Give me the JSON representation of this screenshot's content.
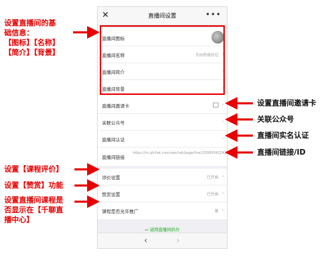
{
  "nav": {
    "close": "✕",
    "title": "直播间设置",
    "more": "•••"
  },
  "groups": {
    "basic": [
      {
        "label": "直播间图标",
        "value": ""
      },
      {
        "label": "直播间名称",
        "value": "大伙的成长记"
      },
      {
        "label": "直播间简介",
        "value": ""
      },
      {
        "label": "直播间背景",
        "value": ""
      }
    ],
    "channel": [
      {
        "label": "直播间邀请卡",
        "value": ""
      },
      {
        "label": "关联公众号",
        "value": ""
      },
      {
        "label": "直播间认证",
        "value": ""
      },
      {
        "label": "直播间链接",
        "value": "https://m.qlchat.com/wechat/page/live/2000004224247772"
      }
    ],
    "course": [
      {
        "label": "评价设置",
        "value": "已开启"
      },
      {
        "label": "赞赏设置",
        "value": "已开启"
      },
      {
        "label": "课程是否允许推广",
        "value": "是"
      }
    ]
  },
  "back_link": "↩ 返回直播间后台",
  "bottom": {
    "prev": "‹",
    "next": "›"
  },
  "chevron": "›",
  "annotations": {
    "basic": [
      "设置直播间的基",
      "础信息：",
      "【图标】【名称】",
      "【简介】【背景】"
    ],
    "invite": "设置直播间邀请卡",
    "account": "关联公众号",
    "auth": "直播间实名认证",
    "link": "直播间链接/ID",
    "eval": "设置【课程评价】",
    "reward": "设置【赞赏】功能",
    "promo": [
      "设置直播间课程是",
      "否显示在【千聊直",
      "播中心】"
    ]
  },
  "colors": {
    "annotation": "#e60000",
    "accent_green": "#1aad19"
  }
}
